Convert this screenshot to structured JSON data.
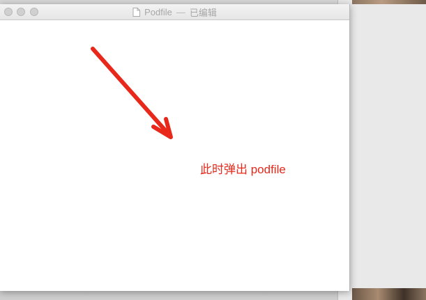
{
  "window": {
    "title": "Podfile",
    "separator": "—",
    "status": "已编辑",
    "controls": {
      "close": "close",
      "minimize": "minimize",
      "zoom": "zoom"
    }
  },
  "annotation": {
    "text": "此时弹出 podfile",
    "color": "#e8281a"
  },
  "arrow": {
    "color": "#e8281a",
    "direction": "down-right"
  },
  "icons": {
    "document": "document-icon",
    "arrow": "arrow-icon"
  }
}
